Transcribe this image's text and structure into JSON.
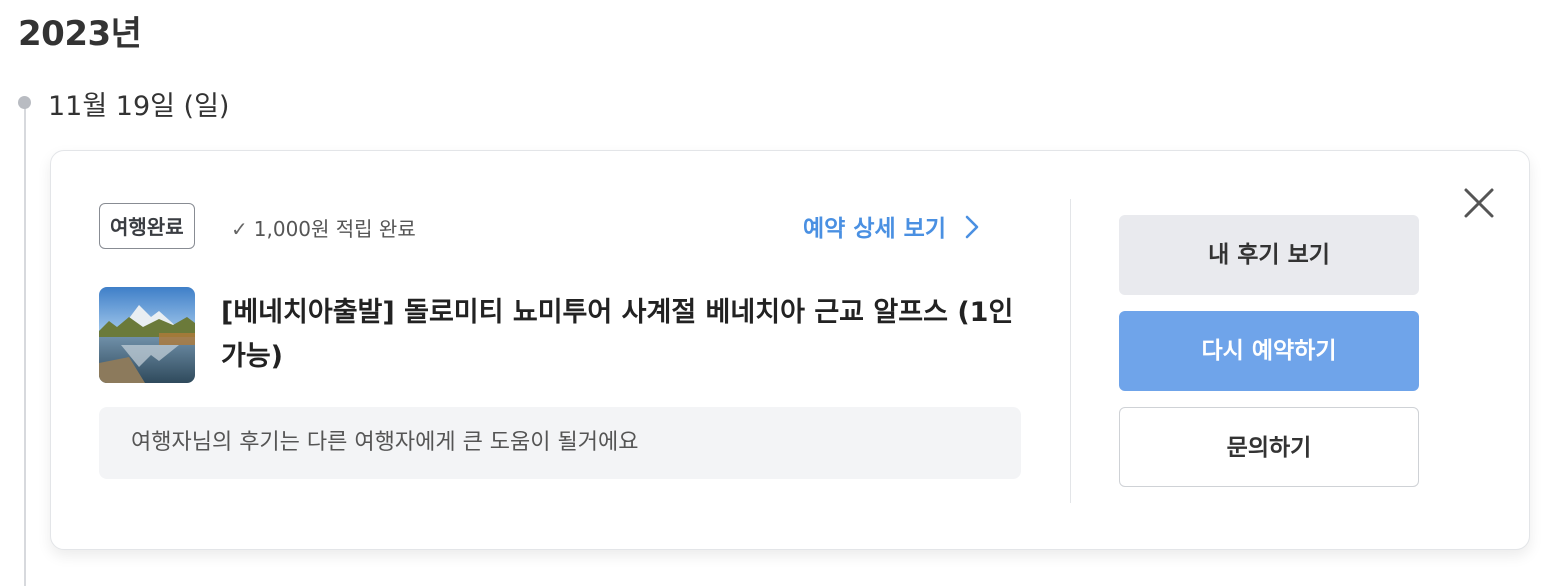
{
  "year_heading": "2023년",
  "date_label": "11월 19일 (일)",
  "card": {
    "status_badge": "여행완료",
    "points_check_icon": "✓",
    "points_text": "1,000원 적립 완료",
    "detail_link": "예약 상세 보기",
    "detail_chevron_icon": "chevron-right-icon",
    "title": "[베네치아출발] 돌로미티 뇨미투어 사계절 베네치아 근교 알프스 (1인가능)",
    "thumbnail": "mountain-lake-thumbnail",
    "review_prompt": "여행자님의 후기는 다른 여행자에게 큰 도움이 될거에요",
    "buttons": {
      "view_review": "내 후기 보기",
      "rebook": "다시 예약하기",
      "inquiry": "문의하기"
    },
    "close_icon": "close-icon"
  },
  "colors": {
    "accent": "#4a90e2",
    "rebook_button": "#6fa4ea",
    "secondary_button": "#e9eaee",
    "review_box": "#f3f4f6"
  }
}
